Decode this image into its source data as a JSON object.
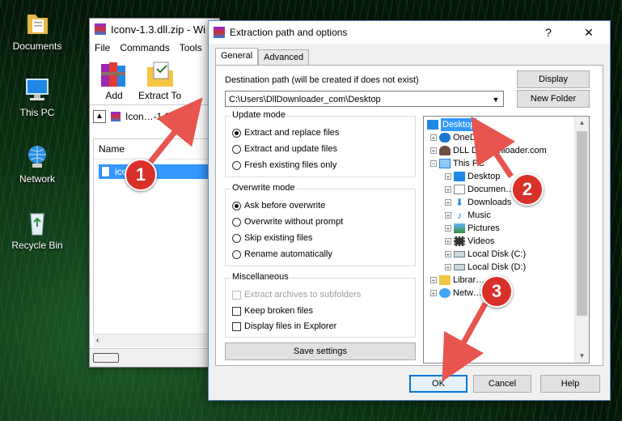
{
  "desktop": {
    "icons": [
      {
        "label": "Documents"
      },
      {
        "label": "This PC"
      },
      {
        "label": "Network"
      },
      {
        "label": "Recycle Bin"
      }
    ]
  },
  "winrar": {
    "title": "Iconv-1.3.dll.zip - Wi",
    "menu": [
      "File",
      "Commands",
      "Tools"
    ],
    "toolbar": {
      "add_label": "Add",
      "extract_label": "Extract To"
    },
    "path_text": "Icon…-1.3.dl",
    "list_header": "Name",
    "file_name": "icon….dll"
  },
  "dialog": {
    "title": "Extraction path and options",
    "help_glyph": "?",
    "close_glyph": "✕",
    "tabs": {
      "general": "General",
      "advanced": "Advanced"
    },
    "destination_label": "Destination path (will be created if does not exist)",
    "destination_value": "C:\\Users\\DllDownloader_com\\Desktop",
    "display_button": "Display",
    "new_folder_button": "New Folder",
    "update_mode": {
      "title": "Update mode",
      "options": [
        "Extract and replace files",
        "Extract and update files",
        "Fresh existing files only"
      ],
      "selected_index": 0
    },
    "overwrite_mode": {
      "title": "Overwrite mode",
      "options": [
        "Ask before overwrite",
        "Overwrite without prompt",
        "Skip existing files",
        "Rename automatically"
      ],
      "selected_index": 0
    },
    "misc": {
      "title": "Miscellaneous",
      "options": [
        {
          "label": "Extract archives to subfolders",
          "checked": false,
          "disabled": true
        },
        {
          "label": "Keep broken files",
          "checked": false,
          "disabled": false
        },
        {
          "label": "Display files in Explorer",
          "checked": false,
          "disabled": false
        }
      ]
    },
    "save_settings_button": "Save settings",
    "tree": {
      "root": "Desktop",
      "items": [
        "OneD…",
        "DLL Dow…nloader.com",
        "This PC",
        "Desktop",
        "Documen…",
        "Downloads",
        "Music",
        "Pictures",
        "Videos",
        "Local Disk (C:)",
        "Local Disk (D:)",
        "Librar…",
        "Netw…"
      ]
    },
    "ok_button": "OK",
    "cancel_button": "Cancel",
    "help_button": "Help"
  },
  "annotations": {
    "step1": "1",
    "step2": "2",
    "step3": "3",
    "color": "#d9302a",
    "arrow_color": "#e8554e"
  }
}
